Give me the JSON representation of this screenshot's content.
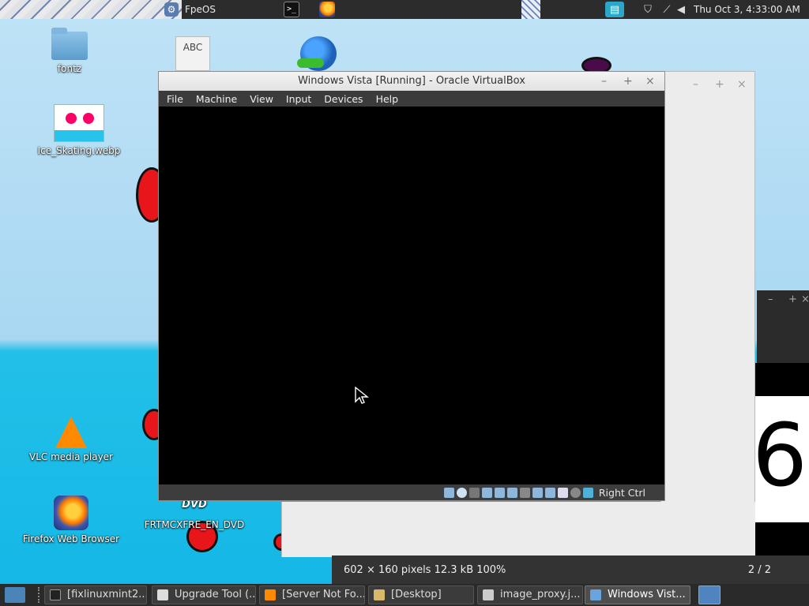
{
  "top_panel": {
    "os_label": "FpeOS",
    "clock": "Thu Oct 3, 4:33:00 AM"
  },
  "desktop_icons": {
    "fontz": "fontz",
    "ice": "Ice_Skating.webp",
    "vlc": "VLC media player",
    "firefox": "Firefox Web Browser",
    "dvd": "FRTMCXFRE_EN_DVD",
    "abc_glyph": "ABC",
    "dvd_glyph": "DVD"
  },
  "vbox": {
    "title": "Windows Vista [Running] - Oracle VirtualBox",
    "menu": [
      "File",
      "Machine",
      "View",
      "Input",
      "Devices",
      "Help"
    ],
    "host_key": "Right Ctrl"
  },
  "viewer": {
    "info": "602 × 160 pixels  12.3 kB   100%",
    "count": "2 / 2",
    "big_glyph": "6"
  },
  "taskbar": {
    "items": [
      "[fixlinuxmint2...",
      "Upgrade Tool (...",
      "[Server Not Fo...",
      "[Desktop]",
      "image_proxy.j...",
      "Windows Vist..."
    ]
  },
  "colors": {
    "accent": "#4f84c1",
    "deco_red": "#e8161b"
  }
}
